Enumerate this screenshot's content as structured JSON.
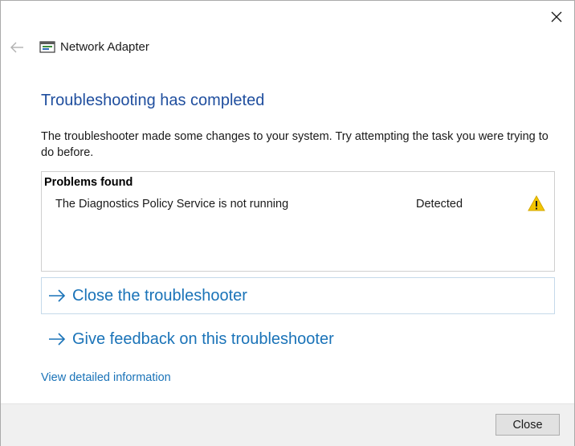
{
  "window": {
    "title": "Network Adapter"
  },
  "main": {
    "heading": "Troubleshooting has completed",
    "description": "The troubleshooter made some changes to your system. Try attempting the task you were trying to do before."
  },
  "problems": {
    "header": "Problems found",
    "items": [
      {
        "name": "The Diagnostics Policy Service is not running",
        "status": "Detected",
        "icon": "warning-icon"
      }
    ]
  },
  "actions": {
    "close_troubleshooter": "Close the troubleshooter",
    "give_feedback": "Give feedback on this troubleshooter",
    "view_details": "View detailed information"
  },
  "footer": {
    "close_label": "Close"
  },
  "colors": {
    "heading": "#1f4e9e",
    "link": "#1a73b8",
    "warning": "#f2c500"
  }
}
